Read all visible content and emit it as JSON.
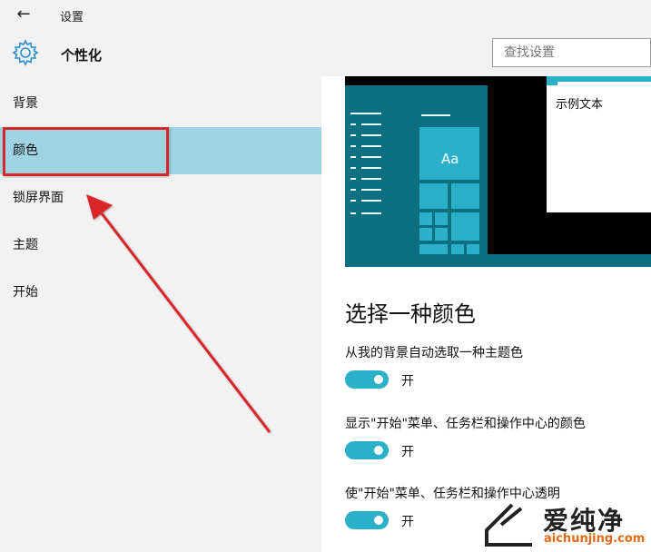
{
  "window": {
    "back_glyph": "←",
    "title": "设置"
  },
  "header": {
    "title": "个性化",
    "search_placeholder": "查找设置"
  },
  "sidebar": {
    "items": [
      {
        "label": "背景"
      },
      {
        "label": "颜色",
        "selected": true
      },
      {
        "label": "锁屏界面"
      },
      {
        "label": "主题"
      },
      {
        "label": "开始"
      }
    ]
  },
  "preview": {
    "tile_text": "Aa",
    "window_text": "示例文本"
  },
  "main": {
    "heading": "选择一种颜色",
    "options": [
      {
        "label": "从我的背景自动选取一种主题色",
        "state": "开",
        "on": true
      },
      {
        "label": "显示\"开始\"菜单、任务栏和操作中心的颜色",
        "state": "开",
        "on": true
      },
      {
        "label": "使\"开始\"菜单、任务栏和操作中心透明",
        "state": "开",
        "on": true
      }
    ]
  },
  "watermark": {
    "brand": "爱纯净",
    "url": "aichunjing.com"
  },
  "colors": {
    "accent": "#2ab0c9",
    "selection": "#9fd5e3",
    "annotation": "#d9262a",
    "preview_bg": "#0d6f80"
  }
}
